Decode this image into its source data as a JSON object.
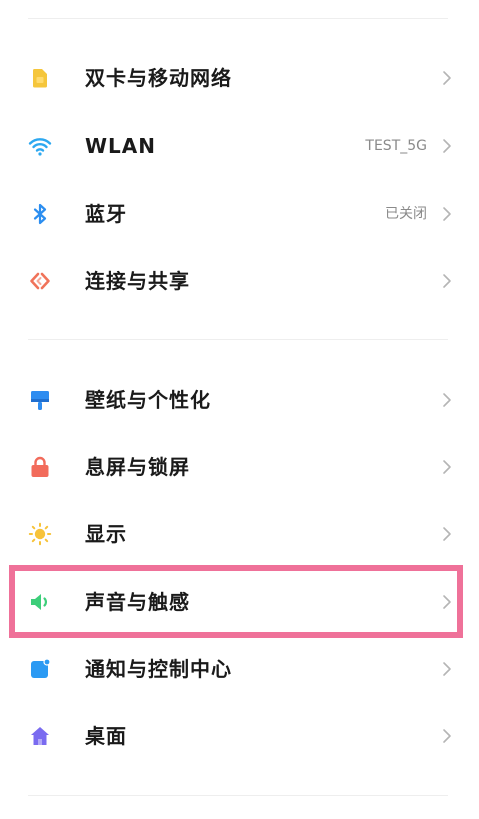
{
  "settings_list": {
    "group1": [
      {
        "id": "dual-sim",
        "label": "双卡与移动网络",
        "value": "",
        "icon": "sim-card-icon",
        "icon_color": "#F5C63C"
      },
      {
        "id": "wlan",
        "label": "WLAN",
        "value": "TEST_5G",
        "icon": "wifi-icon",
        "icon_color": "#2DA8F0"
      },
      {
        "id": "bluetooth",
        "label": "蓝牙",
        "value": "已关闭",
        "icon": "bluetooth-icon",
        "icon_color": "#2C8EF0"
      },
      {
        "id": "connection-sharing",
        "label": "连接与共享",
        "value": "",
        "icon": "share-icon",
        "icon_color": "#F0735A"
      }
    ],
    "group2": [
      {
        "id": "wallpaper",
        "label": "壁纸与个性化",
        "value": "",
        "icon": "paint-brush-icon",
        "icon_color": "#2D8CF0"
      },
      {
        "id": "lock-screen",
        "label": "息屏与锁屏",
        "value": "",
        "icon": "lock-icon",
        "icon_color": "#F26B5B"
      },
      {
        "id": "display",
        "label": "显示",
        "value": "",
        "icon": "sun-icon",
        "icon_color": "#F7C33A"
      },
      {
        "id": "sound",
        "label": "声音与触感",
        "value": "",
        "icon": "speaker-icon",
        "icon_color": "#3DCE7A"
      },
      {
        "id": "notifications",
        "label": "通知与控制中心",
        "value": "",
        "icon": "notification-icon",
        "icon_color": "#2B9AF3"
      },
      {
        "id": "home-screen",
        "label": "桌面",
        "value": "",
        "icon": "home-icon",
        "icon_color": "#7A6BF0"
      }
    ]
  },
  "highlight": {
    "target": "sound",
    "color": "#EF7199"
  },
  "colors": {
    "chevron": "#B5B5B5",
    "value_text": "#8A8A8A",
    "divider": "#EEEEEE"
  }
}
